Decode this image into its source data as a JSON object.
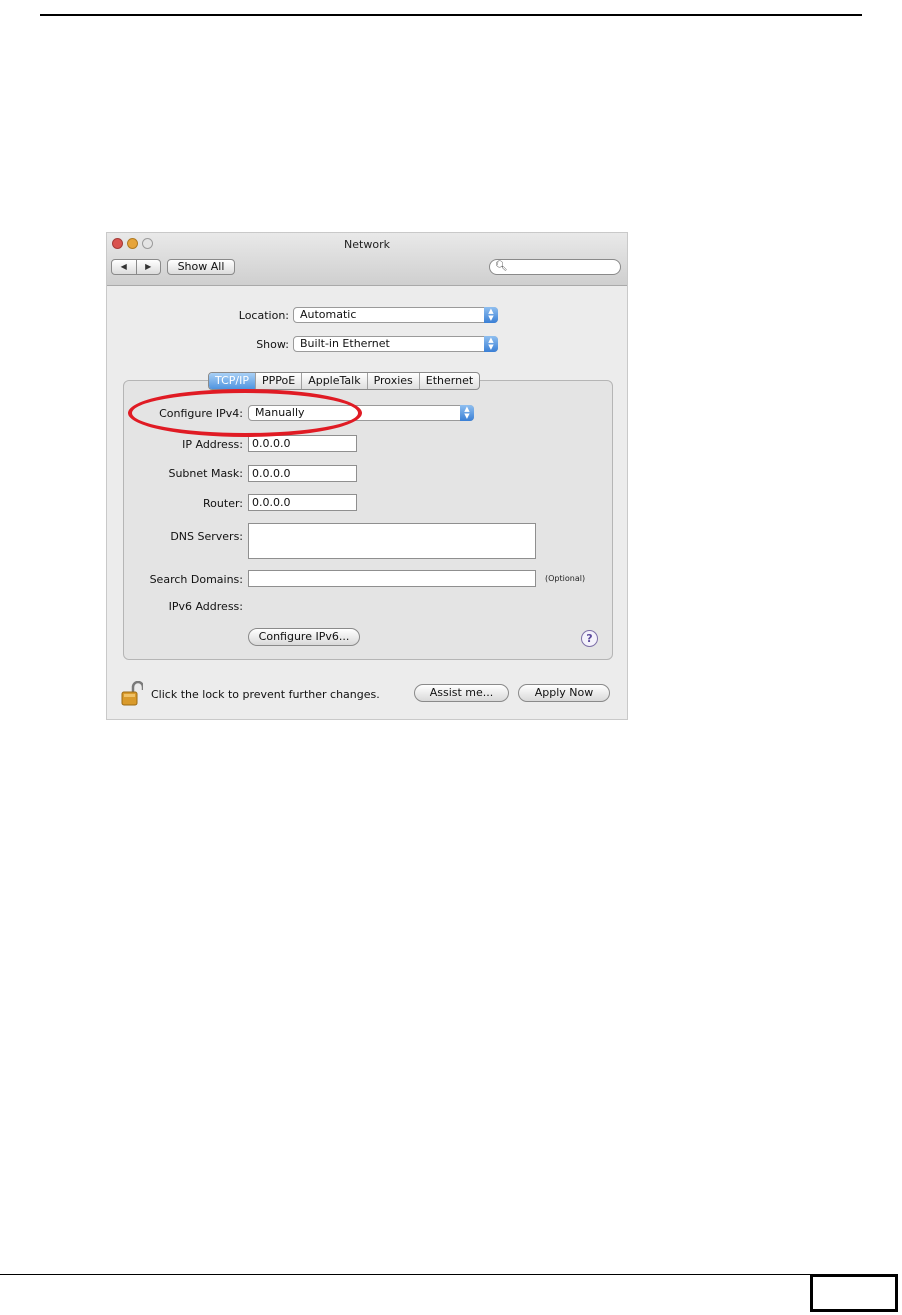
{
  "window": {
    "title": "Network",
    "nav_back": "◀",
    "nav_forward": "▶",
    "show_all_label": "Show All",
    "search_placeholder": ""
  },
  "location": {
    "label": "Location:",
    "value": "Automatic"
  },
  "show": {
    "label": "Show:",
    "value": "Built-in Ethernet"
  },
  "tabs": [
    {
      "label": "TCP/IP",
      "active": true
    },
    {
      "label": "PPPoE",
      "active": false
    },
    {
      "label": "AppleTalk",
      "active": false
    },
    {
      "label": "Proxies",
      "active": false
    },
    {
      "label": "Ethernet",
      "active": false
    }
  ],
  "tcpip": {
    "configure_label": "Configure IPv4:",
    "configure_value": "Manually",
    "ip_label": "IP Address:",
    "ip_value": "0.0.0.0",
    "subnet_label": "Subnet Mask:",
    "subnet_value": "0.0.0.0",
    "router_label": "Router:",
    "router_value": "0.0.0.0",
    "dns_label": "DNS Servers:",
    "dns_value": "",
    "search_domains_label": "Search Domains:",
    "search_domains_value": "",
    "optional_label": "(Optional)",
    "ipv6_label": "IPv6 Address:",
    "configure_ipv6_button": "Configure IPv6...",
    "help_label": "?"
  },
  "footer": {
    "lock_text": "Click the lock to prevent further changes.",
    "assist_button": "Assist me...",
    "apply_button": "Apply Now"
  },
  "colors": {
    "annotation": "#e01b24",
    "active_tab": "#4f94e0"
  }
}
